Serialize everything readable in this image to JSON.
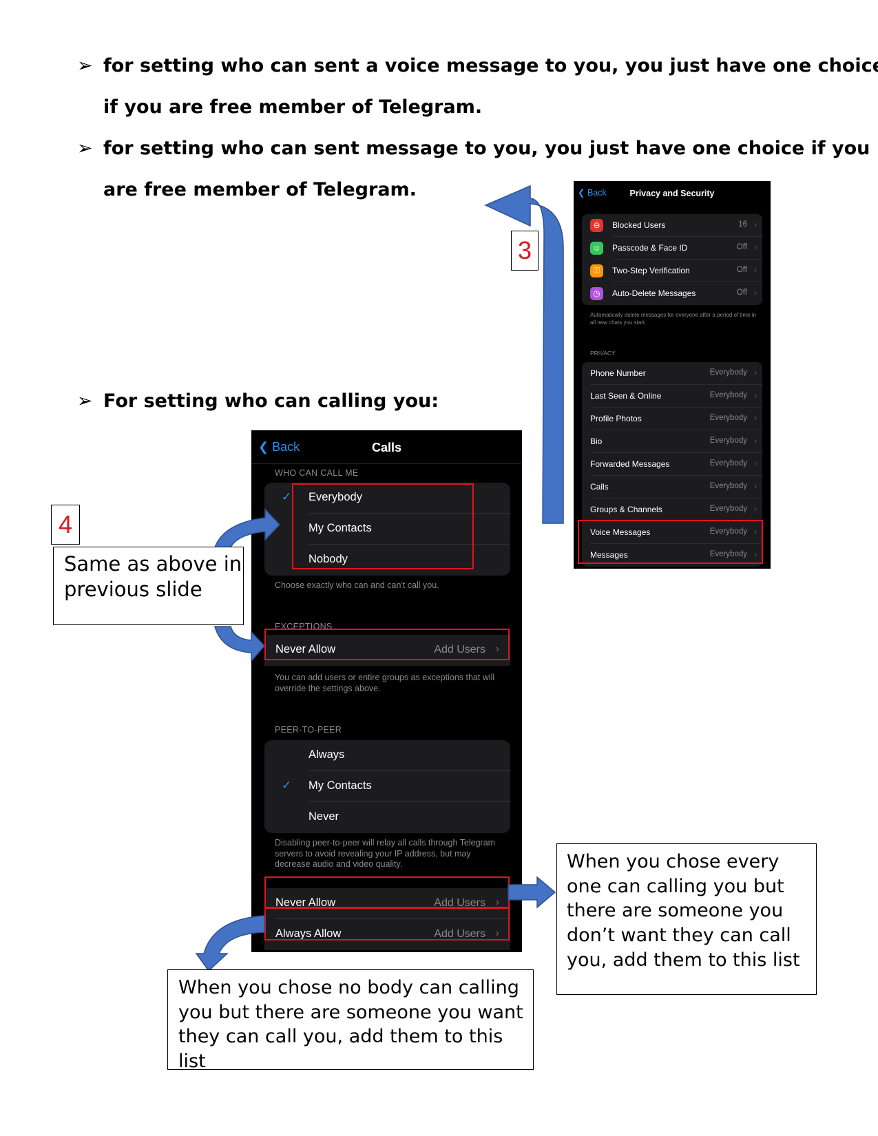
{
  "bullets": {
    "marker": "➢",
    "voice_line1": "for setting who can sent a voice message to  you, you just have one choice",
    "voice_line2": "if you are free member of Telegram.",
    "msg_line1": "for setting who can sent message to you, you just have one choice if you",
    "msg_line2": "are free member of Telegram.",
    "calling": "For setting who can calling you:"
  },
  "privacy_screen": {
    "back_label": "Back",
    "title": "Privacy and Security",
    "security_items": [
      {
        "label": "Blocked Users",
        "value": "16",
        "icon": "minus-circle-icon",
        "color": "#e5342b"
      },
      {
        "label": "Passcode & Face ID",
        "value": "Off",
        "icon": "face-id-icon",
        "color": "#34c759"
      },
      {
        "label": "Two-Step Verification",
        "value": "Off",
        "icon": "key-icon",
        "color": "#ff9500"
      },
      {
        "label": "Auto-Delete Messages",
        "value": "Off",
        "icon": "timer-icon",
        "color": "#af52de"
      }
    ],
    "auto_delete_note": "Automatically delete messages for everyone after a period of time in all new chats you start.",
    "privacy_header": "PRIVACY",
    "privacy_items": [
      {
        "label": "Phone Number",
        "value": "Everybody"
      },
      {
        "label": "Last Seen & Online",
        "value": "Everybody"
      },
      {
        "label": "Profile Photos",
        "value": "Everybody"
      },
      {
        "label": "Bio",
        "value": "Everybody"
      },
      {
        "label": "Forwarded Messages",
        "value": "Everybody"
      },
      {
        "label": "Calls",
        "value": "Everybody"
      },
      {
        "label": "Groups & Channels",
        "value": "Everybody"
      },
      {
        "label": "Voice Messages",
        "value": "Everybody"
      },
      {
        "label": "Messages",
        "value": "Everybody"
      }
    ]
  },
  "calls_screen": {
    "back_label": "Back",
    "title": "Calls",
    "who_header": "WHO CAN CALL ME",
    "who_options": [
      {
        "label": "Everybody",
        "checked": true
      },
      {
        "label": "My Contacts",
        "checked": false
      },
      {
        "label": "Nobody",
        "checked": false
      }
    ],
    "who_note": "Choose exactly who can and can't call you.",
    "exceptions_header": "EXCEPTIONS",
    "never_allow_1": {
      "label": "Never Allow",
      "value": "Add Users"
    },
    "exceptions_note": "You can add users or entire groups as exceptions that will override the settings above.",
    "p2p_header": "PEER-TO-PEER",
    "p2p_options": [
      {
        "label": "Always",
        "checked": false
      },
      {
        "label": "My Contacts",
        "checked": true
      },
      {
        "label": "Never",
        "checked": false
      }
    ],
    "p2p_note": "Disabling peer-to-peer will relay all calls through Telegram servers to avoid revealing your IP address, but may decrease audio and video quality.",
    "never_allow_2": {
      "label": "Never Allow",
      "value": "Add Users"
    },
    "always_allow": {
      "label": "Always Allow",
      "value": "Add Users"
    }
  },
  "annotations": {
    "step3": "3",
    "step4": "4",
    "same_as_above": "Same as above in previous slide",
    "never_allow_callout": "When you chose every one can calling you but there are someone you don’t want they can call you, add them to this list",
    "always_allow_callout": "When you chose no body can calling you but there are someone you want they can call you, add them to this list"
  },
  "colors": {
    "accent_blue": "#2f8ff0",
    "highlight_red": "#e0141e",
    "arrow_blue": "#4472c4"
  }
}
